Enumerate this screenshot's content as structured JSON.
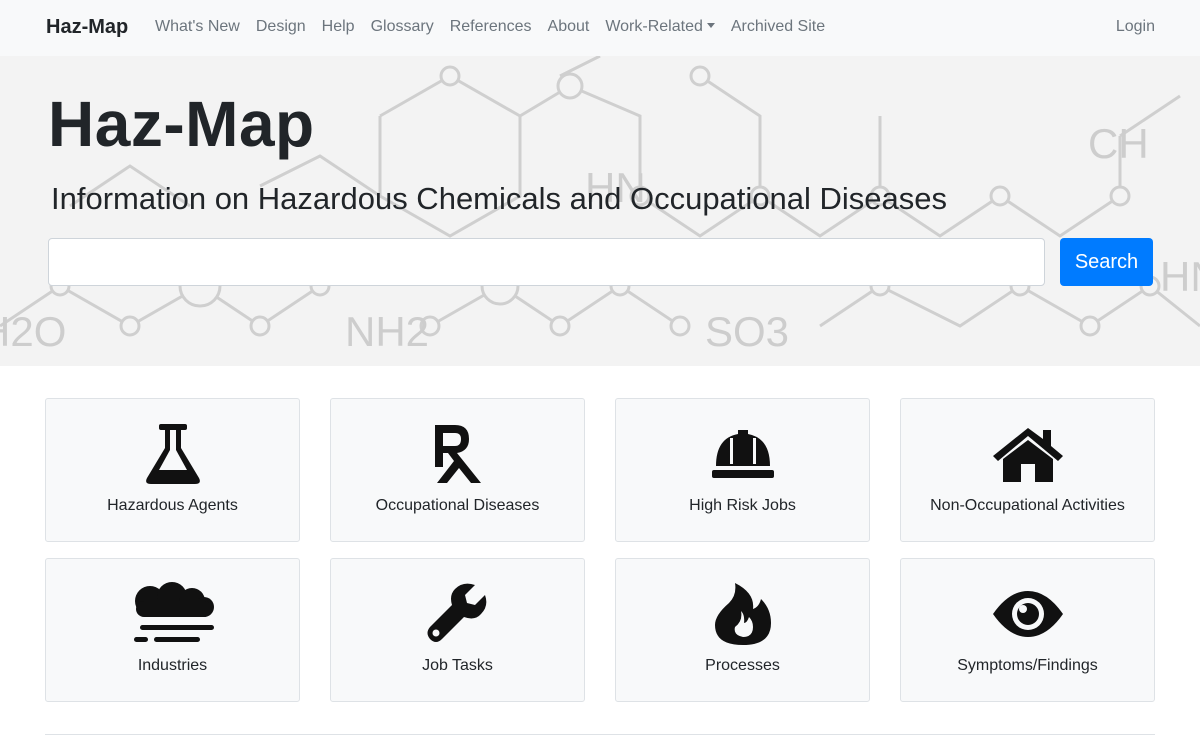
{
  "navbar": {
    "brand": "Haz-Map",
    "links": [
      "What's New",
      "Design",
      "Help",
      "Glossary",
      "References",
      "About",
      "Work-Related",
      "Archived Site"
    ],
    "login": "Login"
  },
  "hero": {
    "title": "Haz-Map",
    "subtitle": "Information on Hazardous Chemicals and Occupational Diseases",
    "search_value": "",
    "search_button": "Search",
    "background_formulas": [
      "CH",
      "HN",
      "NH2",
      "SO3",
      "H2O",
      "HN"
    ]
  },
  "cards": [
    {
      "label": "Hazardous Agents",
      "icon": "flask-icon"
    },
    {
      "label": "Occupational Diseases",
      "icon": "prescription-icon"
    },
    {
      "label": "High Risk Jobs",
      "icon": "hard-hat-icon"
    },
    {
      "label": "Non-Occupational Activities",
      "icon": "home-icon"
    },
    {
      "label": "Industries",
      "icon": "smog-icon"
    },
    {
      "label": "Job Tasks",
      "icon": "wrench-icon"
    },
    {
      "label": "Processes",
      "icon": "fire-icon"
    },
    {
      "label": "Symptoms/Findings",
      "icon": "eye-icon"
    }
  ],
  "colors": {
    "primary": "#007bff",
    "navbar_bg": "#f8f9fa",
    "text": "#212529",
    "muted": "#6c757d"
  }
}
